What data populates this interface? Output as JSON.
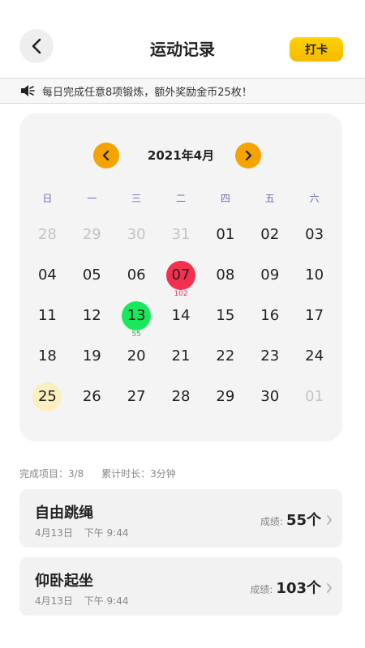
{
  "header": {
    "title": "运动记录",
    "checkin_label": "打卡"
  },
  "notice": {
    "text": "每日完成任意8项锻炼，额外奖励金币25枚！"
  },
  "calendar": {
    "month_label": "2021年4月",
    "weekdays": [
      "日",
      "一",
      "三",
      "二",
      "四",
      "五",
      "六"
    ],
    "rows": [
      [
        {
          "d": "28",
          "muted": true
        },
        {
          "d": "29",
          "muted": true
        },
        {
          "d": "30",
          "muted": true
        },
        {
          "d": "31",
          "muted": true
        },
        {
          "d": "01"
        },
        {
          "d": "02"
        },
        {
          "d": "03"
        }
      ],
      [
        {
          "d": "04"
        },
        {
          "d": "05"
        },
        {
          "d": "06"
        },
        {
          "d": "07",
          "mark": "red",
          "sub": "102"
        },
        {
          "d": "08"
        },
        {
          "d": "09"
        },
        {
          "d": "10"
        }
      ],
      [
        {
          "d": "11"
        },
        {
          "d": "12"
        },
        {
          "d": "13",
          "mark": "green",
          "sub": "55"
        },
        {
          "d": "14"
        },
        {
          "d": "15"
        },
        {
          "d": "16"
        },
        {
          "d": "17"
        }
      ],
      [
        {
          "d": "18"
        },
        {
          "d": "19"
        },
        {
          "d": "20"
        },
        {
          "d": "21"
        },
        {
          "d": "22"
        },
        {
          "d": "23"
        },
        {
          "d": "24"
        }
      ],
      [
        {
          "d": "25",
          "mark": "today"
        },
        {
          "d": "26"
        },
        {
          "d": "27"
        },
        {
          "d": "28"
        },
        {
          "d": "29"
        },
        {
          "d": "30"
        },
        {
          "d": "01",
          "muted": true
        }
      ]
    ]
  },
  "summary": {
    "completed": "完成项目：3/8",
    "duration": "累计时长：3分钟"
  },
  "records": [
    {
      "name": "自由跳绳",
      "date": "4月13日",
      "time": "下午 9:44",
      "score_label": "成绩:",
      "score": "55个"
    },
    {
      "name": "仰卧起坐",
      "date": "4月13日",
      "time": "下午 9:44",
      "score_label": "成绩:",
      "score": "103个"
    }
  ],
  "colors": {
    "accent": "#f5a300",
    "checkin": "#ffd200",
    "marked_red": "#f3304f",
    "marked_green": "#19e85a",
    "today": "#fcefbf"
  }
}
